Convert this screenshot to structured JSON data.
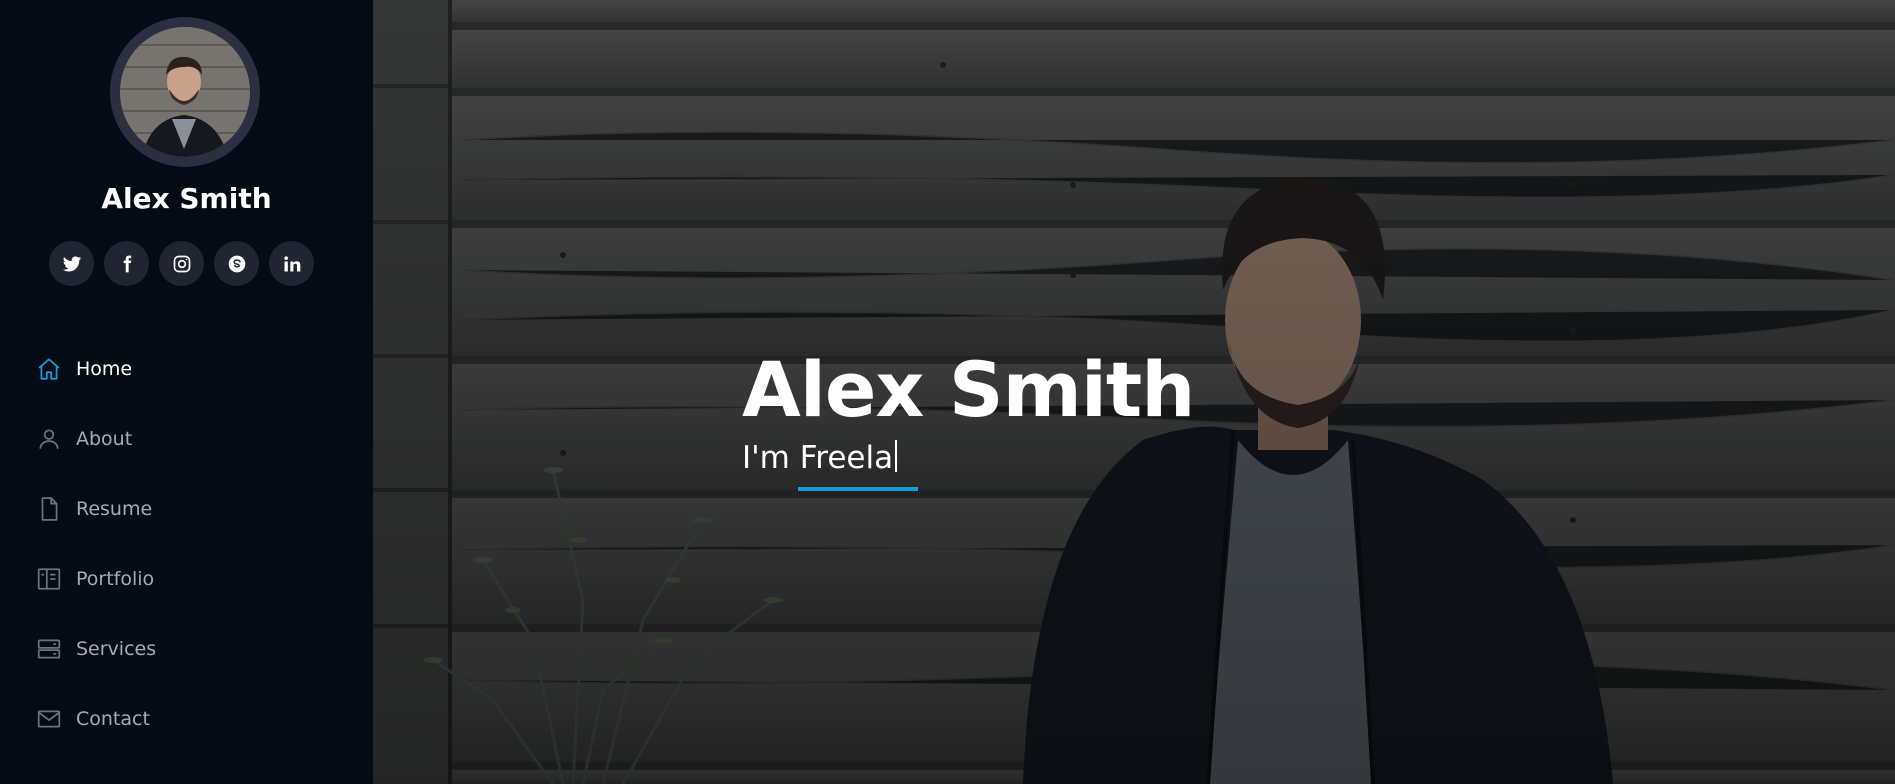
{
  "profile": {
    "name": "Alex Smith"
  },
  "social": [
    {
      "icon": "twitter-icon"
    },
    {
      "icon": "facebook-icon"
    },
    {
      "icon": "instagram-icon"
    },
    {
      "icon": "skype-icon"
    },
    {
      "icon": "linkedin-icon"
    }
  ],
  "nav": {
    "items": [
      {
        "label": "Home",
        "icon": "home-icon",
        "active": true
      },
      {
        "label": "About",
        "icon": "person-icon"
      },
      {
        "label": "Resume",
        "icon": "file-icon"
      },
      {
        "label": "Portfolio",
        "icon": "book-icon"
      },
      {
        "label": "Services",
        "icon": "server-icon"
      },
      {
        "label": "Contact",
        "icon": "envelope-icon"
      }
    ]
  },
  "hero": {
    "title": "Alex Smith",
    "subtitle": "I'm Freela"
  },
  "colors": {
    "accent": "#149ddd",
    "sidebar_bg": "#040b14",
    "social_bg": "#212431",
    "nav_text": "#a8a9b4"
  }
}
